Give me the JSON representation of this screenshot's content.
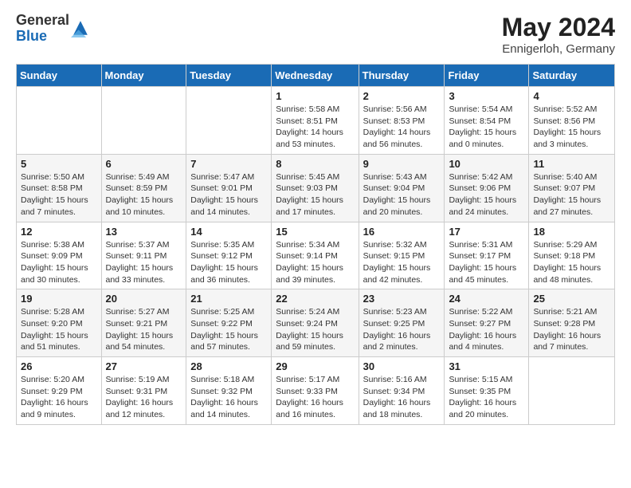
{
  "header": {
    "logo_general": "General",
    "logo_blue": "Blue",
    "month_title": "May 2024",
    "location": "Ennigerloh, Germany"
  },
  "days_of_week": [
    "Sunday",
    "Monday",
    "Tuesday",
    "Wednesday",
    "Thursday",
    "Friday",
    "Saturday"
  ],
  "weeks": [
    [
      {
        "day": "",
        "info": ""
      },
      {
        "day": "",
        "info": ""
      },
      {
        "day": "",
        "info": ""
      },
      {
        "day": "1",
        "info": "Sunrise: 5:58 AM\nSunset: 8:51 PM\nDaylight: 14 hours\nand 53 minutes."
      },
      {
        "day": "2",
        "info": "Sunrise: 5:56 AM\nSunset: 8:53 PM\nDaylight: 14 hours\nand 56 minutes."
      },
      {
        "day": "3",
        "info": "Sunrise: 5:54 AM\nSunset: 8:54 PM\nDaylight: 15 hours\nand 0 minutes."
      },
      {
        "day": "4",
        "info": "Sunrise: 5:52 AM\nSunset: 8:56 PM\nDaylight: 15 hours\nand 3 minutes."
      }
    ],
    [
      {
        "day": "5",
        "info": "Sunrise: 5:50 AM\nSunset: 8:58 PM\nDaylight: 15 hours\nand 7 minutes."
      },
      {
        "day": "6",
        "info": "Sunrise: 5:49 AM\nSunset: 8:59 PM\nDaylight: 15 hours\nand 10 minutes."
      },
      {
        "day": "7",
        "info": "Sunrise: 5:47 AM\nSunset: 9:01 PM\nDaylight: 15 hours\nand 14 minutes."
      },
      {
        "day": "8",
        "info": "Sunrise: 5:45 AM\nSunset: 9:03 PM\nDaylight: 15 hours\nand 17 minutes."
      },
      {
        "day": "9",
        "info": "Sunrise: 5:43 AM\nSunset: 9:04 PM\nDaylight: 15 hours\nand 20 minutes."
      },
      {
        "day": "10",
        "info": "Sunrise: 5:42 AM\nSunset: 9:06 PM\nDaylight: 15 hours\nand 24 minutes."
      },
      {
        "day": "11",
        "info": "Sunrise: 5:40 AM\nSunset: 9:07 PM\nDaylight: 15 hours\nand 27 minutes."
      }
    ],
    [
      {
        "day": "12",
        "info": "Sunrise: 5:38 AM\nSunset: 9:09 PM\nDaylight: 15 hours\nand 30 minutes."
      },
      {
        "day": "13",
        "info": "Sunrise: 5:37 AM\nSunset: 9:11 PM\nDaylight: 15 hours\nand 33 minutes."
      },
      {
        "day": "14",
        "info": "Sunrise: 5:35 AM\nSunset: 9:12 PM\nDaylight: 15 hours\nand 36 minutes."
      },
      {
        "day": "15",
        "info": "Sunrise: 5:34 AM\nSunset: 9:14 PM\nDaylight: 15 hours\nand 39 minutes."
      },
      {
        "day": "16",
        "info": "Sunrise: 5:32 AM\nSunset: 9:15 PM\nDaylight: 15 hours\nand 42 minutes."
      },
      {
        "day": "17",
        "info": "Sunrise: 5:31 AM\nSunset: 9:17 PM\nDaylight: 15 hours\nand 45 minutes."
      },
      {
        "day": "18",
        "info": "Sunrise: 5:29 AM\nSunset: 9:18 PM\nDaylight: 15 hours\nand 48 minutes."
      }
    ],
    [
      {
        "day": "19",
        "info": "Sunrise: 5:28 AM\nSunset: 9:20 PM\nDaylight: 15 hours\nand 51 minutes."
      },
      {
        "day": "20",
        "info": "Sunrise: 5:27 AM\nSunset: 9:21 PM\nDaylight: 15 hours\nand 54 minutes."
      },
      {
        "day": "21",
        "info": "Sunrise: 5:25 AM\nSunset: 9:22 PM\nDaylight: 15 hours\nand 57 minutes."
      },
      {
        "day": "22",
        "info": "Sunrise: 5:24 AM\nSunset: 9:24 PM\nDaylight: 15 hours\nand 59 minutes."
      },
      {
        "day": "23",
        "info": "Sunrise: 5:23 AM\nSunset: 9:25 PM\nDaylight: 16 hours\nand 2 minutes."
      },
      {
        "day": "24",
        "info": "Sunrise: 5:22 AM\nSunset: 9:27 PM\nDaylight: 16 hours\nand 4 minutes."
      },
      {
        "day": "25",
        "info": "Sunrise: 5:21 AM\nSunset: 9:28 PM\nDaylight: 16 hours\nand 7 minutes."
      }
    ],
    [
      {
        "day": "26",
        "info": "Sunrise: 5:20 AM\nSunset: 9:29 PM\nDaylight: 16 hours\nand 9 minutes."
      },
      {
        "day": "27",
        "info": "Sunrise: 5:19 AM\nSunset: 9:31 PM\nDaylight: 16 hours\nand 12 minutes."
      },
      {
        "day": "28",
        "info": "Sunrise: 5:18 AM\nSunset: 9:32 PM\nDaylight: 16 hours\nand 14 minutes."
      },
      {
        "day": "29",
        "info": "Sunrise: 5:17 AM\nSunset: 9:33 PM\nDaylight: 16 hours\nand 16 minutes."
      },
      {
        "day": "30",
        "info": "Sunrise: 5:16 AM\nSunset: 9:34 PM\nDaylight: 16 hours\nand 18 minutes."
      },
      {
        "day": "31",
        "info": "Sunrise: 5:15 AM\nSunset: 9:35 PM\nDaylight: 16 hours\nand 20 minutes."
      },
      {
        "day": "",
        "info": ""
      }
    ]
  ]
}
